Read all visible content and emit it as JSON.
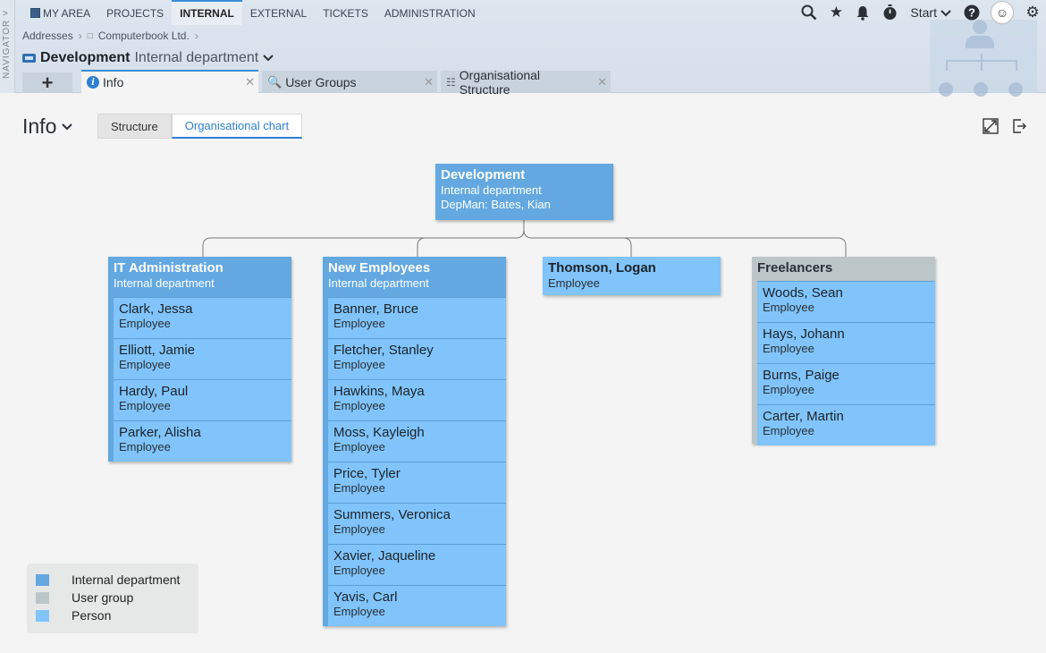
{
  "navigator": {
    "label": "NAVIGATOR"
  },
  "menu": [
    {
      "label": "MY AREA",
      "active": false
    },
    {
      "label": "PROJECTS",
      "active": false
    },
    {
      "label": "INTERNAL",
      "active": true
    },
    {
      "label": "EXTERNAL",
      "active": false
    },
    {
      "label": "TICKETS",
      "active": false
    },
    {
      "label": "ADMINISTRATION",
      "active": false
    }
  ],
  "toolbar": {
    "start_label": "Start",
    "icons": [
      "search-icon",
      "star-icon",
      "bell-icon",
      "stopwatch-icon",
      "help-icon",
      "gear-icon"
    ]
  },
  "breadcrumb": {
    "item1": "Addresses",
    "item2": "Computerbook Ltd."
  },
  "title": {
    "main": "Development",
    "sub": "Internal department"
  },
  "tabs": [
    {
      "label": "Info",
      "icon": "info-icon",
      "active": true
    },
    {
      "label": "User Groups",
      "icon": "user-groups-icon",
      "active": false
    },
    {
      "label": "Organisational Structure",
      "icon": "org-structure-icon",
      "active": false
    }
  ],
  "page": {
    "title": "Info",
    "view_structure": "Structure",
    "view_org_chart": "Organisational chart"
  },
  "org": {
    "root": {
      "name": "Development",
      "type": "Internal department",
      "manager": "DepMan: Bates, Kian"
    },
    "it": {
      "name": "IT Administration",
      "type": "Internal department",
      "members": [
        {
          "name": "Clark, Jessa",
          "role": "Employee"
        },
        {
          "name": "Elliott, Jamie",
          "role": "Employee"
        },
        {
          "name": "Hardy, Paul",
          "role": "Employee"
        },
        {
          "name": "Parker, Alisha",
          "role": "Employee"
        }
      ]
    },
    "newemp": {
      "name": "New Employees",
      "type": "Internal department",
      "members": [
        {
          "name": "Banner, Bruce",
          "role": "Employee"
        },
        {
          "name": "Fletcher, Stanley",
          "role": "Employee"
        },
        {
          "name": "Hawkins, Maya",
          "role": "Employee"
        },
        {
          "name": "Moss, Kayleigh",
          "role": "Employee"
        },
        {
          "name": "Price, Tyler",
          "role": "Employee"
        },
        {
          "name": "Summers, Veronica",
          "role": "Employee"
        },
        {
          "name": "Xavier, Jaqueline",
          "role": "Employee"
        },
        {
          "name": "Yavis, Carl",
          "role": "Employee"
        }
      ]
    },
    "thomson": {
      "name": "Thomson, Logan",
      "role": "Employee"
    },
    "freelancers": {
      "name": "Freelancers",
      "members": [
        {
          "name": "Woods, Sean",
          "role": "Employee"
        },
        {
          "name": "Hays, Johann",
          "role": "Employee"
        },
        {
          "name": "Burns, Paige",
          "role": "Employee"
        },
        {
          "name": "Carter, Martin",
          "role": "Employee"
        }
      ]
    }
  },
  "legend": [
    {
      "label": "Internal department",
      "color": "#63a8e1"
    },
    {
      "label": "User group",
      "color": "#bcc6c8"
    },
    {
      "label": "Person",
      "color": "#80c4fb"
    }
  ]
}
